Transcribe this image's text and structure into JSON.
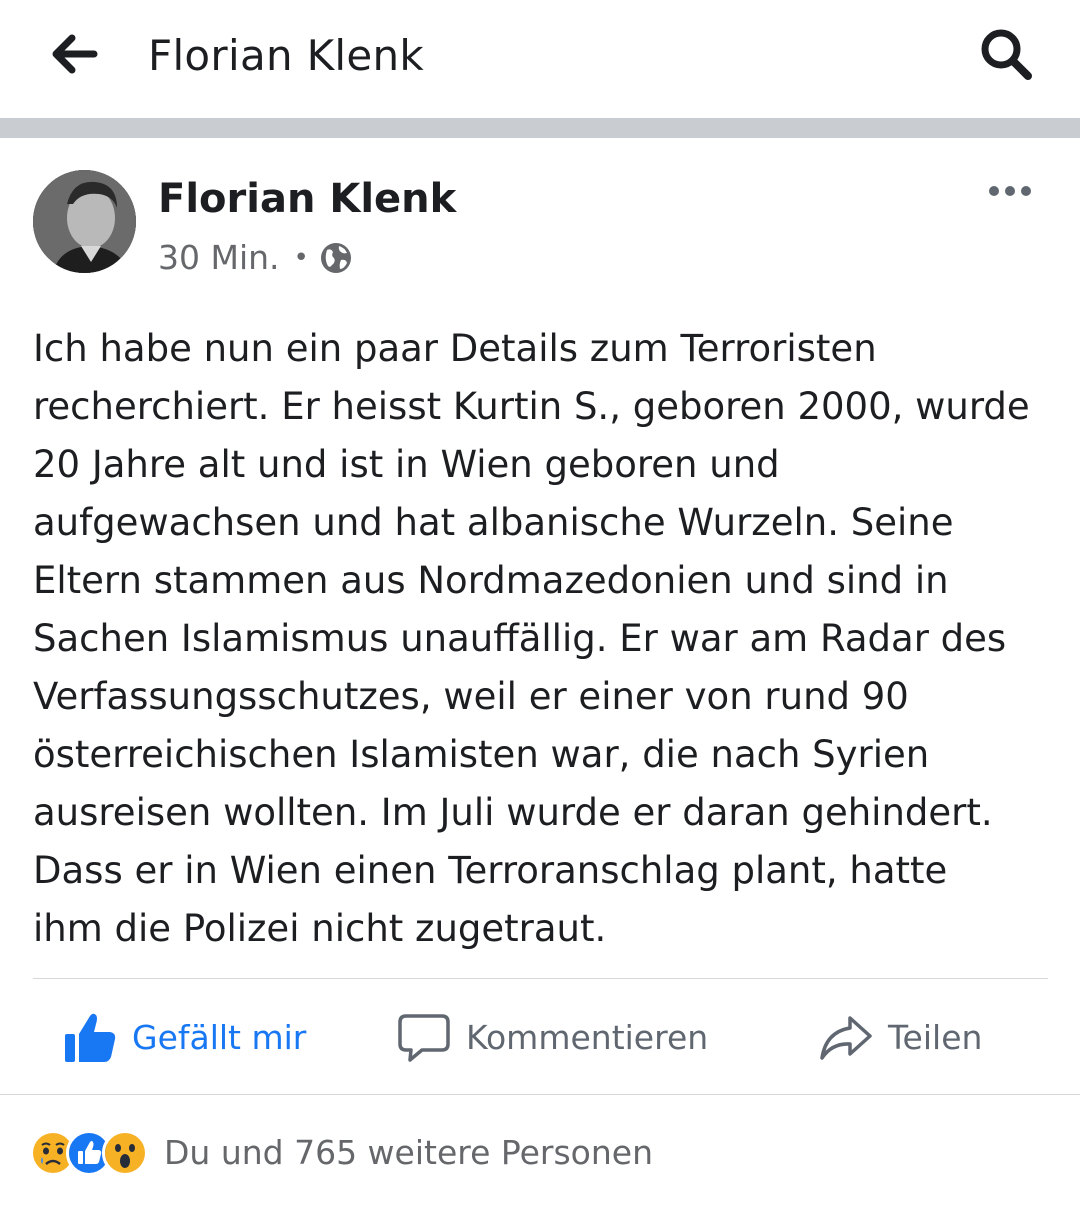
{
  "header": {
    "title": "Florian Klenk"
  },
  "post": {
    "author": "Florian Klenk",
    "timestamp": "30 Min.",
    "separator": "•",
    "privacy_icon": "globe-icon",
    "text_lines": [
      "Ich habe nun ein paar Details zum Terroristen",
      "recherchiert. Er heisst Kurtin S., geboren 2000, wurde",
      "20 Jahre alt und ist in Wien geboren und",
      "aufgewachsen und hat albanische Wurzeln. Seine",
      "Eltern stammen aus Nordmazedonien und sind in",
      "Sachen Islamismus unauffällig. Er war am Radar des",
      "Verfassungsschutzes, weil er einer von rund 90",
      "österreichischen Islamisten war, die nach Syrien",
      "ausreisen wollten. Im Juli wurde er daran gehindert.",
      "Dass er in Wien einen Terroranschlag plant, hatte",
      "ihm die Polizei nicht zugetraut."
    ]
  },
  "actions": {
    "like_label": "Gefällt mir",
    "comment_label": "Kommentieren",
    "share_label": "Teilen"
  },
  "reactions": {
    "icons": [
      "sad-reaction-icon",
      "like-reaction-icon",
      "wow-reaction-icon"
    ],
    "summary": "Du und 765 weitere Personen"
  },
  "colors": {
    "accent": "#1877f2",
    "divider": "#c9ccd1",
    "secondary_text": "#65676b"
  }
}
